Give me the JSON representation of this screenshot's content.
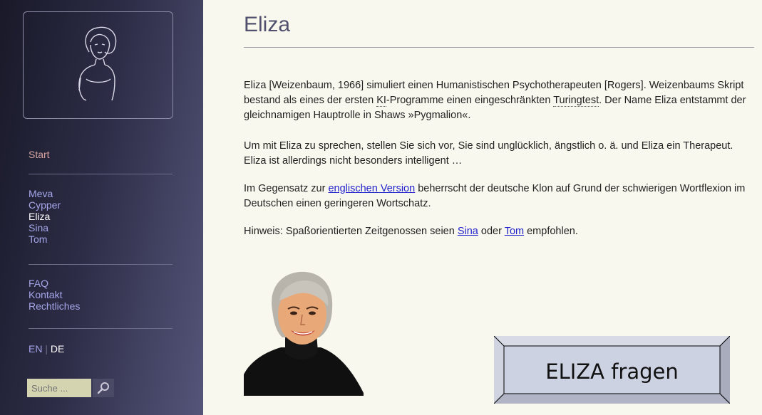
{
  "sidebar": {
    "start": "Start",
    "nav_group1": [
      "Meva",
      "Cypper",
      "Eliza",
      "Sina",
      "Tom"
    ],
    "nav_group2": [
      "FAQ",
      "Kontakt",
      "Rechtliches"
    ],
    "lang": {
      "en": "EN",
      "sep": "|",
      "de": "DE"
    },
    "search": {
      "placeholder": "Suche ..."
    }
  },
  "main": {
    "title": "Eliza",
    "p1": {
      "t1": "Eliza [Weizenbaum, 1966] simuliert einen Humanistischen Psychotherapeuten [Rogers]. Weizenbaums Skript bestand als eines der ersten ",
      "ki": "KI",
      "t2": "-Programme einen eingeschränkten ",
      "turing": "Turingtest",
      "t3": ". Der Name Eliza entstammt der gleichnamigen Hauptrolle in Shaws »Pygmalion«."
    },
    "p2": "Um mit Eliza zu sprechen, stellen Sie sich vor, Sie sind unglücklich, ängstlich o. ä. und Eliza ein Therapeut. Eliza ist allerdings nicht besonders intelligent …",
    "p3": {
      "t1": "Im Gegensatz zur ",
      "link": "englischen Version",
      "t2": " beherrscht der deutsche Klon auf Grund der schwierigen Wortflexion im Deutschen einen geringeren Wortschatz."
    },
    "p4": {
      "t1": "Hinweis: Spaßorientierten Zeitgenossen seien ",
      "sina": "Sina",
      "t2": " oder ",
      "tom": "Tom",
      "t3": " empfohlen."
    },
    "ask_button": "ELIZA fragen"
  },
  "colors": {
    "accent_link": "#2222cc",
    "nav_link": "#a6a6ea",
    "start_link": "#d8a4a0",
    "title": "#50506e"
  }
}
